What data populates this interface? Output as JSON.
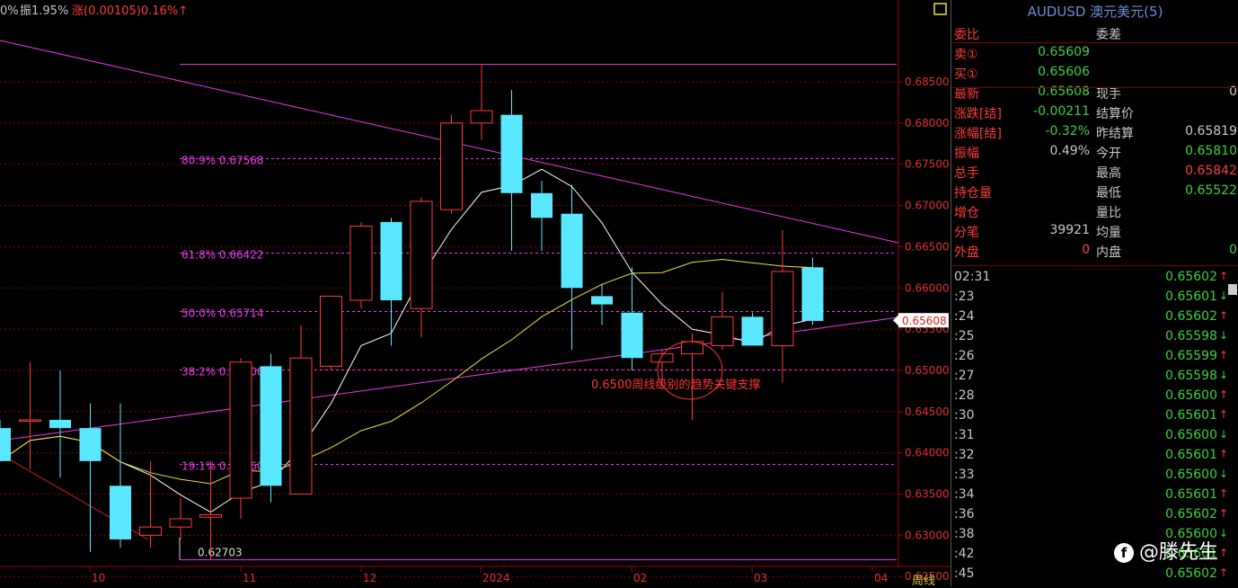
{
  "header": {
    "prefix": "0%",
    "amplitude": "振1.95%",
    "change": "涨(0.00105)0.16%↑"
  },
  "chart": {
    "period": "周线",
    "fib_levels": [
      {
        "label": "80.9% 0.67568",
        "value": 0.67568
      },
      {
        "label": "61.8% 0.66422",
        "value": 0.66422
      },
      {
        "label": "50.0% 0.65714",
        "value": 0.65714
      },
      {
        "label": "38.2% 0.65006",
        "value": 0.65006
      },
      {
        "label": "19.1% 0.63860",
        "value": 0.6386
      }
    ],
    "price_labels": [
      "0.68500",
      "0.68000",
      "0.67500",
      "0.67000",
      "0.66500",
      "0.66000",
      "0.65500",
      "0.65000",
      "0.64500",
      "0.64000",
      "0.63500",
      "0.63000",
      "0.62500"
    ],
    "price_values": [
      0.685,
      0.68,
      0.675,
      0.67,
      0.665,
      0.66,
      0.655,
      0.65,
      0.645,
      0.64,
      0.635,
      0.63,
      0.625
    ],
    "current_price": "0.65608",
    "current_price_value": 0.65608,
    "low_label": "0.62703",
    "low_value": 0.62703,
    "annotation": "0.6500周线级别的趋势关键支撑",
    "time_labels": [
      "10",
      "11",
      "12",
      "2024",
      "02",
      "03",
      "04"
    ],
    "candles": [
      {
        "o": 0.643,
        "h": 0.644,
        "l": 0.639,
        "c": 0.639
      },
      {
        "o": 0.644,
        "h": 0.651,
        "l": 0.638,
        "c": 0.644
      },
      {
        "o": 0.644,
        "h": 0.65,
        "l": 0.637,
        "c": 0.643
      },
      {
        "o": 0.643,
        "h": 0.646,
        "l": 0.628,
        "c": 0.639
      },
      {
        "o": 0.636,
        "h": 0.646,
        "l": 0.6285,
        "c": 0.6295
      },
      {
        "o": 0.63,
        "h": 0.639,
        "l": 0.6285,
        "c": 0.631
      },
      {
        "o": 0.631,
        "h": 0.6345,
        "l": 0.6295,
        "c": 0.632
      },
      {
        "o": 0.6322,
        "h": 0.639,
        "l": 0.627,
        "c": 0.6325
      },
      {
        "o": 0.6345,
        "h": 0.6515,
        "l": 0.632,
        "c": 0.651
      },
      {
        "o": 0.6505,
        "h": 0.652,
        "l": 0.634,
        "c": 0.636
      },
      {
        "o": 0.635,
        "h": 0.6555,
        "l": 0.635,
        "c": 0.6515
      },
      {
        "o": 0.6505,
        "h": 0.659,
        "l": 0.65,
        "c": 0.659
      },
      {
        "o": 0.6585,
        "h": 0.668,
        "l": 0.6575,
        "c": 0.6675
      },
      {
        "o": 0.668,
        "h": 0.6685,
        "l": 0.653,
        "c": 0.6585
      },
      {
        "o": 0.6575,
        "h": 0.671,
        "l": 0.654,
        "c": 0.6705
      },
      {
        "o": 0.6695,
        "h": 0.681,
        "l": 0.669,
        "c": 0.68
      },
      {
        "o": 0.68,
        "h": 0.687,
        "l": 0.678,
        "c": 0.6815
      },
      {
        "o": 0.681,
        "h": 0.684,
        "l": 0.6645,
        "c": 0.6715
      },
      {
        "o": 0.6715,
        "h": 0.673,
        "l": 0.6645,
        "c": 0.6685
      },
      {
        "o": 0.669,
        "h": 0.6725,
        "l": 0.6525,
        "c": 0.66
      },
      {
        "o": 0.659,
        "h": 0.6605,
        "l": 0.6555,
        "c": 0.658
      },
      {
        "o": 0.657,
        "h": 0.6625,
        "l": 0.65,
        "c": 0.6515
      },
      {
        "o": 0.651,
        "h": 0.6525,
        "l": 0.6485,
        "c": 0.652
      },
      {
        "o": 0.652,
        "h": 0.6545,
        "l": 0.644,
        "c": 0.6535
      },
      {
        "o": 0.653,
        "h": 0.6595,
        "l": 0.6525,
        "c": 0.6565
      },
      {
        "o": 0.6565,
        "h": 0.657,
        "l": 0.653,
        "c": 0.653
      },
      {
        "o": 0.653,
        "h": 0.667,
        "l": 0.6485,
        "c": 0.662
      },
      {
        "o": 0.6625,
        "h": 0.6637,
        "l": 0.6555,
        "c": 0.656
      }
    ],
    "colors": {
      "up": "#ff3b3b",
      "down": "#59e8ff",
      "fib": "#e93ae9",
      "trend": "#e93ae9",
      "ma_short": "#ffffff",
      "ma_long": "#e8e23a",
      "grid": "#8b0000",
      "axis_text": "#e03030",
      "time_text": "#e03030",
      "annotation": "#ff3333"
    }
  },
  "panel": {
    "title": "AUDUSD 澳元美元(5)",
    "rows": [
      {
        "l1": "委比",
        "v1": "",
        "l2": "委差",
        "v2": ""
      },
      {
        "l1": "卖①",
        "v1": "0.65609",
        "l2": "",
        "v2": "",
        "c1": "#3cd23c"
      },
      {
        "l1": "买①",
        "v1": "0.65606",
        "l2": "",
        "v2": "",
        "c1": "#3cd23c"
      },
      {
        "l1": "最新",
        "v1": "0.65608",
        "l2": "现手",
        "v2": "0",
        "c1": "#3cd23c",
        "lc1": "#ff3b3b",
        "c2": "#c8c8c8"
      },
      {
        "l1": "涨跌[结]",
        "v1": "-0.00211",
        "l2": "结算价",
        "v2": "",
        "c1": "#3cd23c"
      },
      {
        "l1": "涨幅[结]",
        "v1": "-0.32%",
        "l2": "昨结算",
        "v2": "0.65819",
        "c1": "#3cd23c",
        "c2": "#c8c8c8"
      },
      {
        "l1": "振幅",
        "v1": "0.49%",
        "l2": "今开",
        "v2": "0.65810",
        "c1": "#c8c8c8",
        "c2": "#3cd23c"
      },
      {
        "l1": "总手",
        "v1": "",
        "l2": "最高",
        "v2": "0.65842",
        "c2": "#ff3b3b",
        "lc1": "#ff3b3b"
      },
      {
        "l1": "持仓量",
        "v1": "",
        "l2": "最低",
        "v2": "0.65522",
        "c2": "#3cd23c"
      },
      {
        "l1": "增仓",
        "v1": "",
        "l2": "量比",
        "v2": ""
      },
      {
        "l1": "分笔",
        "v1": "39921",
        "l2": "均量",
        "v2": "",
        "c1": "#c8c8c8"
      },
      {
        "l1": "外盘",
        "v1": "0",
        "l2": "内盘",
        "v2": "0",
        "c1": "#ff3b3b",
        "c2": "#3cd23c"
      }
    ],
    "ticks": [
      {
        "t": "02:31",
        "p": "0.65602",
        "a": "↑"
      },
      {
        "t": ":23",
        "p": "0.65601",
        "a": "↓"
      },
      {
        "t": ":24",
        "p": "0.65602",
        "a": "↑"
      },
      {
        "t": ":25",
        "p": "0.65598",
        "a": "↓"
      },
      {
        "t": ":26",
        "p": "0.65599",
        "a": "↑"
      },
      {
        "t": ":27",
        "p": "0.65598",
        "a": "↓"
      },
      {
        "t": ":28",
        "p": "0.65600",
        "a": "↑"
      },
      {
        "t": ":30",
        "p": "0.65601",
        "a": "↑"
      },
      {
        "t": ":31",
        "p": "0.65600",
        "a": "↓"
      },
      {
        "t": ":32",
        "p": "0.65601",
        "a": "↑"
      },
      {
        "t": ":33",
        "p": "0.65600",
        "a": "↓"
      },
      {
        "t": ":34",
        "p": "0.65601",
        "a": "↑"
      },
      {
        "t": ":36",
        "p": "0.65602",
        "a": "↑"
      },
      {
        "t": ":38",
        "p": "0.65600",
        "a": "↓"
      },
      {
        "t": ":42",
        "p": "0.65601",
        "a": "↑"
      },
      {
        "t": ":45",
        "p": "0.65602",
        "a": "↑"
      }
    ]
  },
  "watermark": {
    "icon": "f",
    "text": "@滕先生"
  }
}
